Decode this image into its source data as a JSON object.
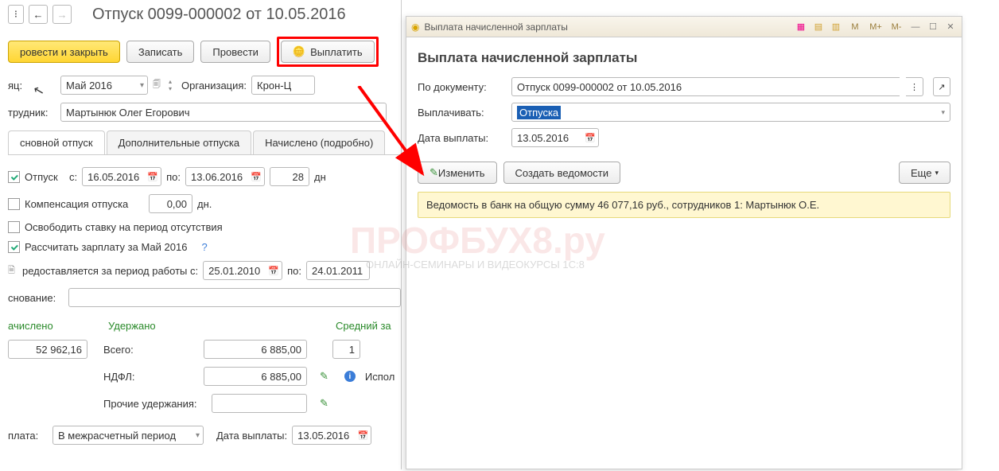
{
  "left": {
    "title": "Отпуск 0099-000002 от 10.05.2016",
    "toolbar": {
      "save_close": "ровести и закрыть",
      "write": "Записать",
      "post": "Провести",
      "pay": "Выплатить"
    },
    "month_lbl": "яц:",
    "month_val": "Май 2016",
    "org_lbl": "Организация:",
    "org_val": "Крон-Ц",
    "emp_lbl": "трудник:",
    "emp_val": "Мартынюк Олег Егорович",
    "tabs": {
      "main": "сновной отпуск",
      "add": "Дополнительные отпуска",
      "calc": "Начислено (подробно)"
    },
    "vac_lbl": "Отпуск",
    "from_lbl": "с:",
    "date_from": "16.05.2016",
    "to_lbl": "по:",
    "date_to": "13.06.2016",
    "days": "28",
    "days_suffix": "дн",
    "comp_lbl": "Компенсация отпуска",
    "comp_val": "0,00",
    "comp_suffix": "дн.",
    "free_lbl": "Освободить ставку на период отсутствия",
    "calc_lbl": "Рассчитать зарплату за Май 2016",
    "period_lbl": "редоставляется за период работы с:",
    "period_from": "25.01.2010",
    "period_to": "24.01.2011",
    "basis_lbl": "снование:",
    "accrued_lbl": "ачислено",
    "withheld_lbl": "Удержано",
    "avg_lbl": "Средний за",
    "accrued_val": "52 962,16",
    "total_lbl": "Всего:",
    "total_val": "6 885,00",
    "ndfl_lbl": "НДФЛ:",
    "ndfl_val": "6 885,00",
    "other_lbl": "Прочие удержания:",
    "used_lbl": "Испол",
    "pay_lbl": "плата:",
    "pay_period": "В межрасчетный период",
    "pay_date_lbl": "Дата выплаты:",
    "pay_date": "13.05.2016",
    "one": "1"
  },
  "right": {
    "titlebar": "Выплата начисленной зарплаты",
    "mem": {
      "m": "M",
      "mplus": "M+",
      "mminus": "M-"
    },
    "title": "Выплата начисленной зарплаты",
    "doc_lbl": "По документу:",
    "doc_val": "Отпуск 0099-000002 от 10.05.2016",
    "pay_lbl": "Выплачивать:",
    "pay_val": "Отпуска",
    "date_lbl": "Дата выплаты:",
    "date_val": "13.05.2016",
    "edit_btn": "Изменить",
    "create_btn": "Создать ведомости",
    "more_btn": "Еще",
    "info": "Ведомость в банк на общую сумму 46 077,16 руб., сотрудников 1: Мартынюк О.Е."
  },
  "watermark": {
    "main": "ПРОФБУХ8.ру",
    "sub": "ОНЛАЙН-СЕМИНАРЫ И ВИДЕОКУРСЫ 1С:8"
  }
}
